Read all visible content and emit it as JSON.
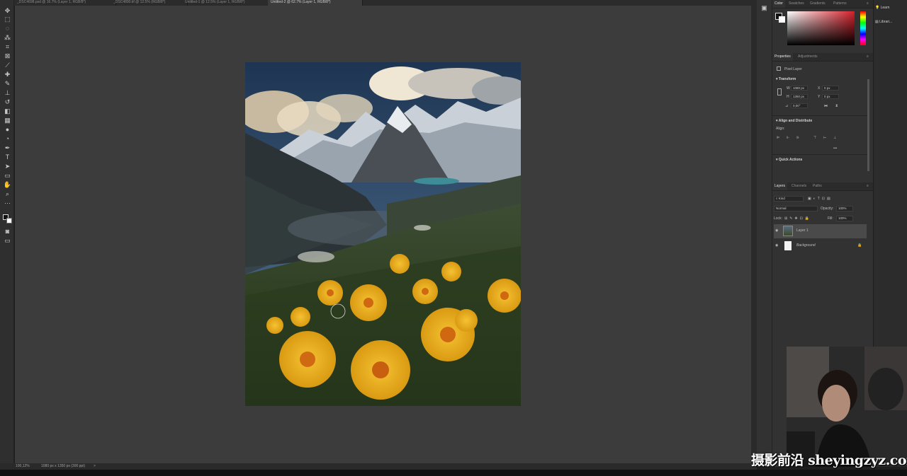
{
  "tabs": [
    {
      "label": "_DSC4698.psd @ 16.7% (Layer 1, RGB/8*)"
    },
    {
      "label": "_DSC4890.tif @ 12.5% (RGB/8*)"
    },
    {
      "label": "Untitled-1 @ 12.5% (Layer 1, RGB/8*)"
    },
    {
      "label": "Untitled-2 @ 62.7% (Layer 1, RGB/8*)",
      "active": true
    }
  ],
  "statusbar": {
    "zoom": "100,12%",
    "doc_info": "1080 px x 1350 px (300 ppi)",
    "arrow": ">"
  },
  "color_panel": {
    "tabs": [
      "Color",
      "Swatches",
      "Gradients",
      "Patterns"
    ],
    "accent_hue": "#d4202a"
  },
  "properties_panel": {
    "tabs": [
      "Properties",
      "Adjustments"
    ],
    "layer_kind": "Pixel Layer",
    "transform_title": "Transform",
    "w_label": "W",
    "w_value": "1080 px",
    "h_label": "H",
    "h_value": "1350 px",
    "x_label": "X",
    "x_value": "0 px",
    "y_label": "Y",
    "y_value": "0 px",
    "angle": "0,00°",
    "align_title": "Align and Distribute",
    "align_label": "Align:",
    "more": "•••",
    "quick_actions": "Quick Actions"
  },
  "layers_panel": {
    "tabs": [
      "Layers",
      "Channels",
      "Paths"
    ],
    "filter_kind": "Kind",
    "blend_mode": "Normal",
    "opacity_label": "Opacity:",
    "opacity_value": "100%",
    "lock_label": "Lock:",
    "fill_label": "Fill:",
    "fill_value": "100%",
    "layers": [
      {
        "name": "Layer 1",
        "selected": true
      },
      {
        "name": "Background",
        "locked": true
      }
    ]
  },
  "right_column": {
    "learn": "Learn",
    "libraries": "Librari..."
  },
  "watermark": "摄影前沿 sheyingzyz.com"
}
